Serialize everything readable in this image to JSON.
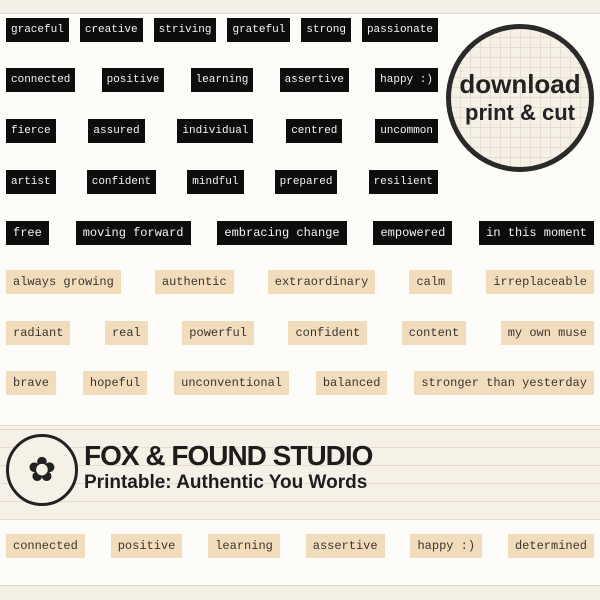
{
  "black_rows": [
    [
      "graceful",
      "creative",
      "striving",
      "grateful",
      "strong",
      "passionate"
    ],
    [
      "connected",
      "positive",
      "learning",
      "assertive",
      "happy :)"
    ],
    [
      "fierce",
      "assured",
      "individual",
      "centred",
      "uncommon"
    ],
    [
      "artist",
      "confident",
      "mindful",
      "prepared",
      "resilient"
    ],
    [
      "free",
      "moving forward",
      "embracing change",
      "empowered",
      "in this moment"
    ]
  ],
  "tan_rows": [
    [
      "always growing",
      "authentic",
      "extraordinary",
      "calm",
      "irreplaceable"
    ],
    [
      "radiant",
      "real",
      "powerful",
      "confident",
      "content",
      "my own muse"
    ],
    [
      "brave",
      "hopeful",
      "unconventional",
      "balanced",
      "stronger than yesterday"
    ]
  ],
  "bottom_row": [
    "connected",
    "positive",
    "learning",
    "assertive",
    "happy :)",
    "determined"
  ],
  "banner": {
    "brand": "FOX & FOUND STUDIO",
    "subtitle": "Printable: Authentic You Words"
  },
  "badge": {
    "line1": "download",
    "line2": "print & cut"
  },
  "colors": {
    "label_black": "#0d0d0d",
    "label_tan": "#f1dcbc",
    "paper": "#f6f1e6"
  }
}
